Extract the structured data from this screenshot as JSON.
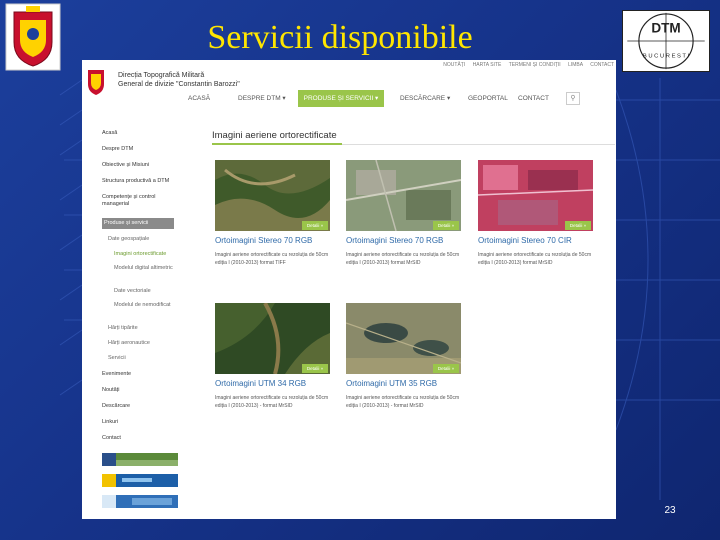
{
  "slide": {
    "title": "Servicii disponibile",
    "page_number": "23",
    "logo_text": "DTM",
    "logo_subtext": "B U C U R E S T I",
    "title_color": "#ffe600",
    "background_color": "#1a3a94"
  },
  "site": {
    "org_line1": "Direcția Topografică Militară",
    "org_line2": "General de divizie \"Constantin Barozzi\"",
    "top_links": [
      "NOUTĂȚI",
      "HARTA SITE",
      "TERMENI ȘI CONDIȚII",
      "LIMBA",
      "CONTACT"
    ],
    "nav": [
      {
        "label": "ACASĂ"
      },
      {
        "label": "DESPRE DTM ▾"
      },
      {
        "label": "PRODUSE ȘI SERVICII ▾"
      },
      {
        "label": "DESCĂRCARE ▾"
      },
      {
        "label": "GEOPORTAL"
      },
      {
        "label": "CONTACT"
      }
    ],
    "search_icon": "search-icon",
    "accent_color": "#9ac54a",
    "sidebar": [
      "Acasă",
      "Despre DTM",
      "Obiective și Misiuni",
      "Structura productivă a DTM",
      "Competențe și control managerial",
      "Produse și servicii",
      "Date geospațiale",
      "Imagini ortorectificate",
      "Modelul digital altimetric",
      "Date vectoriale",
      "Modelul de nemodificat",
      "Hărți tipărite",
      "Hărți aeronautice",
      "Servicii",
      "Evenimente",
      "Noutăți",
      "Descărcare",
      "Linkuri",
      "Contact"
    ],
    "content_title": "Imagini aeriene ortorectificate",
    "detail_label": "Detalii »",
    "cards": [
      {
        "title": "Ortoimagini Stereo 70 RGB",
        "desc": "Imagini aeriene ortorectificate cu rezoluția de 50cm ediția I (2010-2013) format TIFF"
      },
      {
        "title": "Ortoimagini Stereo 70 RGB",
        "desc": "Imagini aeriene ortorectificate cu rezoluția de 50cm ediția I (2010-2013) format MrSID"
      },
      {
        "title": "Ortoimagini Stereo 70 CIR",
        "desc": "Imagini aeriene ortorectificate cu rezoluția de 50cm ediția I (2010-2013) format MrSID"
      },
      {
        "title": "Ortoimagini UTM 34 RGB",
        "desc": "Imagini aeriene ortorectificate cu rezoluția de 50cm ediția I (2010-2013) - format MrSID"
      },
      {
        "title": "Ortoimagini UTM 35 RGB",
        "desc": "Imagini aeriene ortorectificate cu rezoluția de 50cm ediția I (2010-2013) - format MrSID"
      }
    ]
  }
}
